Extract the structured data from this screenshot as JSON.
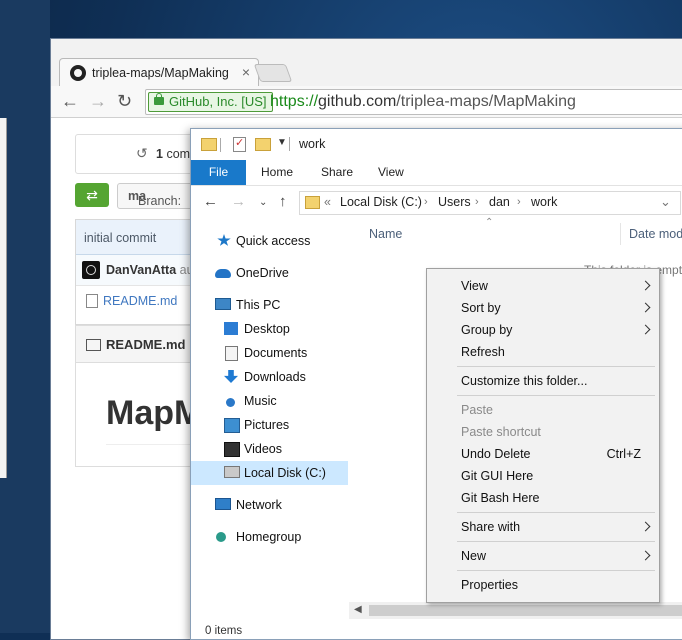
{
  "chrome": {
    "tab_title": "triplea-maps/MapMaking",
    "tab_close": "×",
    "back": "←",
    "forward": "→",
    "reload": "↻",
    "security_label": "GitHub, Inc. [US]",
    "url_scheme": "https://",
    "url_host": "github.com",
    "url_path": "/triplea-maps/MapMaking"
  },
  "github": {
    "commits_count": "1",
    "commits_label": "com",
    "compare_icon": "⇄",
    "branch_label": "Branch: ",
    "branch_value": "ma",
    "commit_message": "initial commit",
    "author": "DanVanAtta",
    "author_suffix": " au",
    "file_name": "README.md",
    "readme_header": "README.md",
    "readme_heading": "MapM"
  },
  "explorer": {
    "title": "work",
    "ribbon_tabs": [
      "File",
      "Home",
      "Share",
      "View"
    ],
    "address": {
      "prefix": "«",
      "crumbs": [
        "Local Disk (C:)",
        "Users",
        "dan",
        "work"
      ],
      "separator": "›"
    },
    "nav": [
      {
        "label": "Quick access",
        "icon": "star-icon"
      },
      {
        "label": "OneDrive",
        "icon": "cloud-icon"
      },
      {
        "label": "This PC",
        "icon": "computer-icon"
      },
      {
        "label": "Desktop",
        "icon": "desktop-icon"
      },
      {
        "label": "Documents",
        "icon": "documents-icon"
      },
      {
        "label": "Downloads",
        "icon": "downloads-icon"
      },
      {
        "label": "Music",
        "icon": "music-icon"
      },
      {
        "label": "Pictures",
        "icon": "pictures-icon"
      },
      {
        "label": "Videos",
        "icon": "videos-icon"
      },
      {
        "label": "Local Disk (C:)",
        "icon": "disk-icon",
        "selected": true
      },
      {
        "label": "Network",
        "icon": "network-icon"
      },
      {
        "label": "Homegroup",
        "icon": "homegroup-icon"
      }
    ],
    "columns": {
      "name": "Name",
      "date": "Date mod"
    },
    "empty_message": "This folder is empty.",
    "status": "0 items"
  },
  "context_menu": {
    "items": [
      {
        "label": "View",
        "submenu": true
      },
      {
        "label": "Sort by",
        "submenu": true
      },
      {
        "label": "Group by",
        "submenu": true
      },
      {
        "label": "Refresh"
      },
      {
        "label": "Customize this folder..."
      },
      {
        "label": "Paste",
        "disabled": true
      },
      {
        "label": "Paste shortcut",
        "disabled": true
      },
      {
        "label": "Undo Delete",
        "shortcut": "Ctrl+Z"
      },
      {
        "label": "Git GUI Here"
      },
      {
        "label": "Git Bash Here"
      },
      {
        "label": "Share with",
        "submenu": true
      },
      {
        "label": "New",
        "submenu": true
      },
      {
        "label": "Properties"
      }
    ]
  }
}
